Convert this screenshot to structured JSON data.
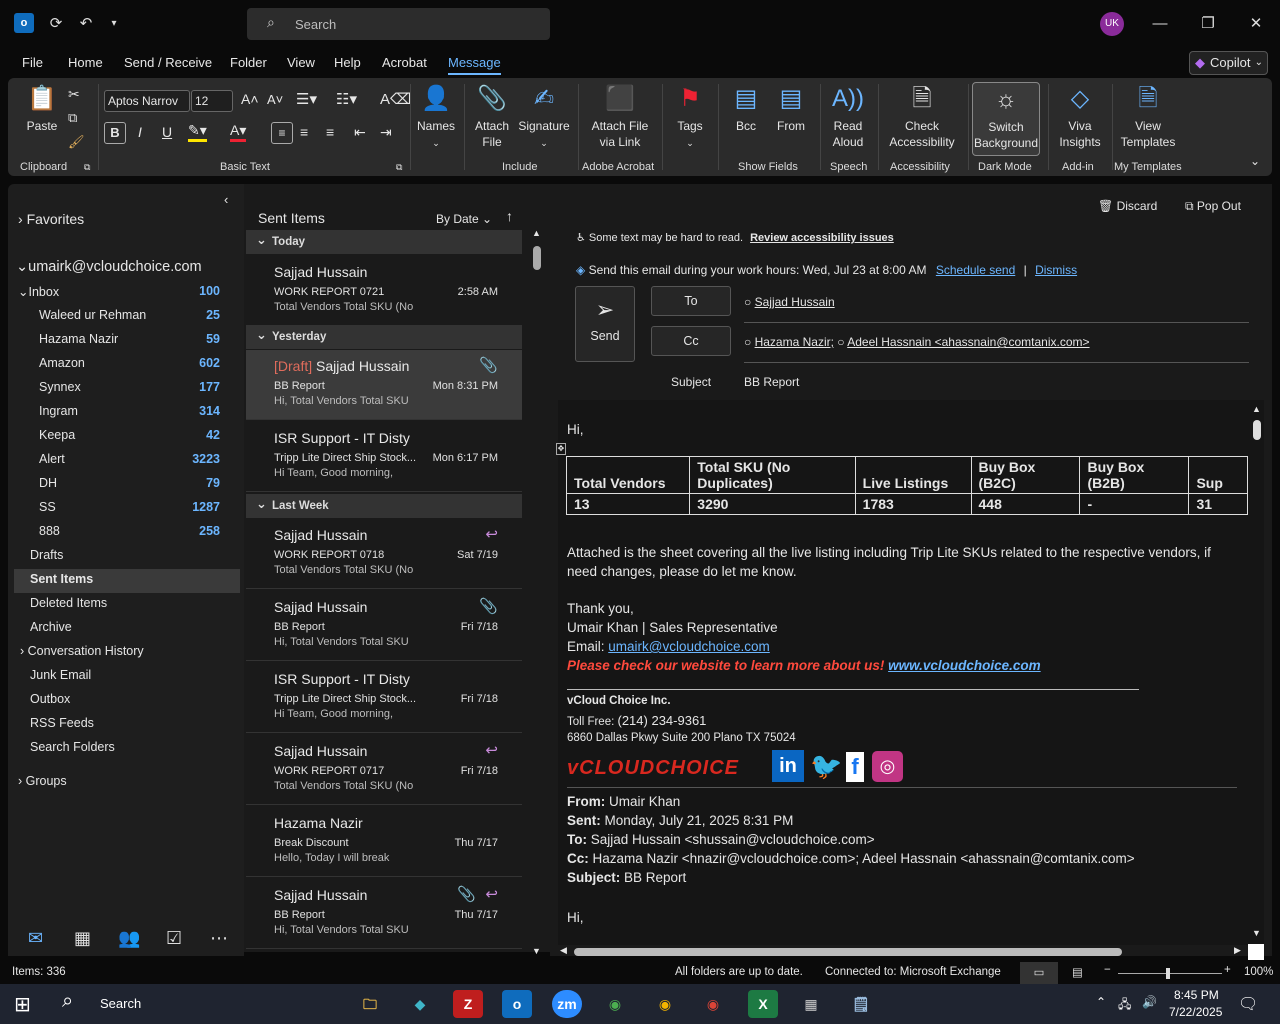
{
  "title": {
    "search_placeholder": "Search",
    "avatar_initials": "UK"
  },
  "menu": [
    "File",
    "Home",
    "Send / Receive",
    "Folder",
    "View",
    "Help",
    "Acrobat",
    "Message"
  ],
  "copilot": "Copilot",
  "ribbon": {
    "paste": "Paste",
    "font_name": "Aptos Narrov",
    "font_size": "12",
    "names": "Names",
    "attach_file": "Attach\nFile",
    "signature": "Signature",
    "attach_link": "Attach File\nvia Link",
    "tags": "Tags",
    "bcc": "Bcc",
    "from": "From",
    "read_aloud": "Read\nAloud",
    "check_access": "Check\nAccessibility",
    "switch_bg": "Switch\nBackground",
    "viva": "Viva\nInsights",
    "templates": "View\nTemplates",
    "groups": [
      "Clipboard",
      "Basic Text",
      "Include",
      "Adobe Acrobat",
      "Show Fields",
      "Speech",
      "Accessibility",
      "Dark Mode",
      "Add-in",
      "My Templates"
    ]
  },
  "folders": {
    "favorites": "Favorites",
    "account": "umairk@vcloudchoice.com",
    "inbox": {
      "label": "Inbox",
      "count": "100"
    },
    "subs": [
      {
        "label": "Waleed ur Rehman",
        "count": "25"
      },
      {
        "label": "Hazama Nazir",
        "count": "59"
      },
      {
        "label": "Amazon",
        "count": "602"
      },
      {
        "label": "Synnex",
        "count": "177"
      },
      {
        "label": "Ingram",
        "count": "314"
      },
      {
        "label": "Keepa",
        "count": "42"
      },
      {
        "label": "Alert",
        "count": "3223"
      },
      {
        "label": "DH",
        "count": "79"
      },
      {
        "label": "SS",
        "count": "1287"
      },
      {
        "label": "888",
        "count": "258"
      }
    ],
    "others": [
      "Drafts",
      "Sent Items",
      "Deleted Items",
      "Archive",
      "Conversation History",
      "Junk Email",
      "Outbox",
      "RSS Feeds",
      "Search Folders"
    ],
    "groups": "Groups"
  },
  "list": {
    "title": "Sent Items",
    "sort": "By Date",
    "groups": [
      "Today",
      "Yesterday",
      "Last Week"
    ],
    "items": [
      {
        "from": "Sajjad Hussain",
        "subj": "WORK REPORT 0721",
        "time": "2:58 AM",
        "prev": "Total Vendors  Total SKU (No"
      },
      {
        "draft": "[Draft]",
        "from": "Sajjad Hussain",
        "subj": "BB Report",
        "time": "Mon 8:31 PM",
        "prev": "Hi,  Total Vendors  Total SKU"
      },
      {
        "from": "ISR Support - IT Disty",
        "subj": "Tripp Lite Direct Ship Stock...",
        "time": "Mon 6:17 PM",
        "prev": "Hi Team,  Good morning,"
      },
      {
        "from": "Sajjad Hussain",
        "subj": "WORK REPORT 0718",
        "time": "Sat 7/19",
        "prev": "Total Vendors  Total SKU (No"
      },
      {
        "from": "Sajjad Hussain",
        "subj": "BB Report",
        "time": "Fri 7/18",
        "prev": "Hi,  Total Vendors  Total SKU"
      },
      {
        "from": "ISR Support - IT Disty",
        "subj": "Tripp Lite Direct Ship Stock...",
        "time": "Fri 7/18",
        "prev": "Hi Team,  Good morning,"
      },
      {
        "from": "Sajjad Hussain",
        "subj": "WORK REPORT 0717",
        "time": "Fri 7/18",
        "prev": "Total Vendors  Total SKU (No"
      },
      {
        "from": "Hazama Nazir",
        "subj": "Break Discount",
        "time": "Thu 7/17",
        "prev": "Hello,  Today I will break"
      },
      {
        "from": "Sajjad Hussain",
        "subj": "BB Report",
        "time": "Thu 7/17",
        "prev": "Hi,  Total Vendors  Total SKU"
      }
    ]
  },
  "reading": {
    "discard": "Discard",
    "popout": "Pop Out",
    "access_msg": "Some text may be hard to read.",
    "access_link": "Review accessibility issues",
    "sched_msg": "Send this email during your work hours: Wed, Jul 23 at 8:00 AM",
    "sched_link": "Schedule send",
    "sep": "|",
    "dismiss": "Dismiss",
    "send": "Send",
    "to": "To",
    "cc": "Cc",
    "subject_label": "Subject",
    "to_value": "Sajjad Hussain",
    "cc1": "Hazama Nazir;",
    "cc2": "Adeel Hassnain <ahassnain@comtanix.com>",
    "subject": "BB Report"
  },
  "email": {
    "greeting": "Hi,",
    "table_headers": [
      "Total Vendors",
      "Total SKU (No Duplicates)",
      "Live Listings",
      "Buy Box (B2C)",
      "Buy Box (B2B)",
      "Sup"
    ],
    "table_values": [
      "13",
      "3290",
      "1783",
      "448",
      "-",
      "31"
    ],
    "para1": "Attached is the sheet covering all the live listing including Trip Lite SKUs related to the respective vendors, if",
    "para2": "need changes, please do let me know.",
    "thanks": "Thank you,",
    "sig_name": "Umair Khan | Sales Representative",
    "email_label": "Email: ",
    "email_link": "umairk@vcloudchoice.com",
    "promo": "Please check our website to learn more about us! ",
    "promo_link": "www.vcloudchoice.com",
    "company": "vCloud Choice Inc.",
    "tollfree_label": "Toll Free: ",
    "tollfree": "(214) 234-9361",
    "address": "6860 Dallas Pkwy Suite 200 Plano TX 75024",
    "logo": "vCLOUDCHOICE",
    "from_label": "From:",
    "from_v": " Umair Khan",
    "sent_label": "Sent:",
    "sent_v": " Monday, July 21, 2025 8:31 PM",
    "to_label": "To:",
    "to_v": " Sajjad Hussain <shussain@vcloudchoice.com>",
    "cc_label": "Cc:",
    "cc_v": " Hazama Nazir <hnazir@vcloudchoice.com>; Adeel Hassnain <ahassnain@comtanix.com>",
    "subj_label": "Subject:",
    "subj_v": " BB Report",
    "greeting2": "Hi,"
  },
  "status": {
    "items": "Items: 336",
    "sync": "All folders are up to date.",
    "conn": "Connected to: Microsoft Exchange",
    "zoom": "100%"
  },
  "taskbar": {
    "search": "Search",
    "time": "8:45 PM",
    "date": "7/22/2025"
  }
}
